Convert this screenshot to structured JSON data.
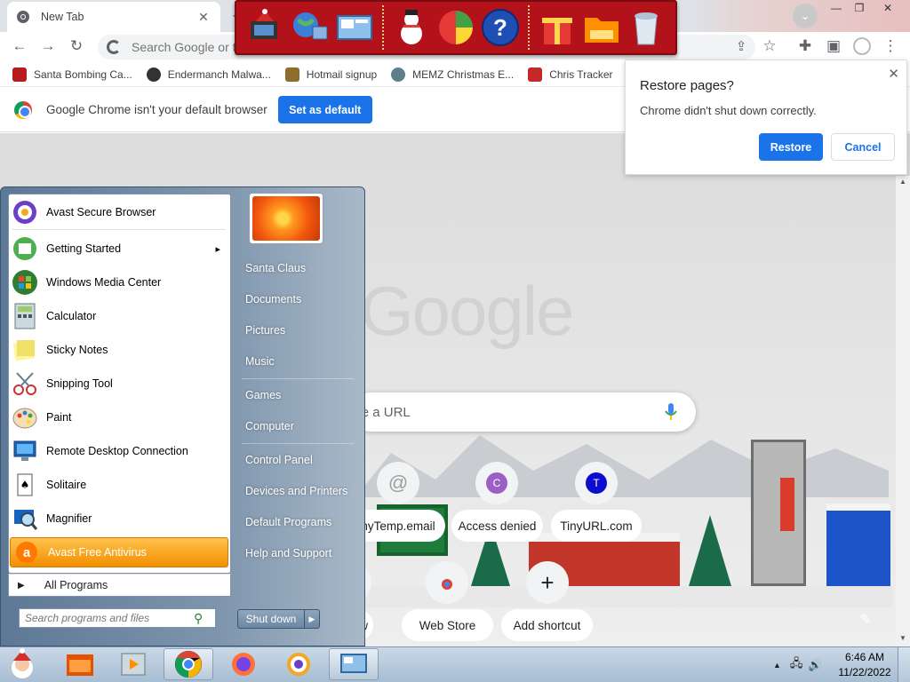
{
  "browser": {
    "tab_title": "New Tab",
    "omnibox_placeholder": "Search Google or type a URL",
    "bookmarks": [
      {
        "label": "Santa Bombing Ca...",
        "icon": "santa-icon",
        "color": "#b71c1c"
      },
      {
        "label": "Endermanch Malwa...",
        "icon": "skull-icon",
        "color": "#333333"
      },
      {
        "label": "Hotmail signup",
        "icon": "trophy-icon",
        "color": "#8d6e2b"
      },
      {
        "label": "MEMZ Christmas E...",
        "icon": "gear-icon",
        "color": "#607d8b"
      },
      {
        "label": "Chris Tracker",
        "icon": "star-icon",
        "color": "#c62828"
      }
    ],
    "infobar": {
      "message": "Google Chrome isn't your default browser",
      "button": "Set as default"
    },
    "restore_popup": {
      "title": "Restore pages?",
      "message": "Chrome didn't shut down correctly.",
      "restore": "Restore",
      "cancel": "Cancel"
    },
    "ntp": {
      "logo": "Google",
      "search_placeholder": "Search Google or type a URL",
      "shortcuts": [
        {
          "label": "TempTinyTemp.email",
          "visible_label": "nyTemp.email",
          "letter": "@",
          "color": "#9e9e9e"
        },
        {
          "label": "Access denied",
          "letter": "C",
          "color": "#9c5fc6"
        },
        {
          "label": "TinyURL.com",
          "letter": "T",
          "color": "#0d0dcf"
        }
      ],
      "bottom_shortcuts": [
        {
          "label": "w"
        },
        {
          "label": "Web Store"
        },
        {
          "label": "Add shortcut",
          "letter": "+"
        }
      ]
    }
  },
  "start_menu": {
    "programs": [
      {
        "label": "Avast Secure Browser",
        "icon": "avast-browser-icon"
      },
      {
        "label": "Getting Started",
        "icon": "getting-started-icon",
        "submenu": "▸"
      },
      {
        "label": "Windows Media Center",
        "icon": "media-center-icon"
      },
      {
        "label": "Calculator",
        "icon": "calculator-icon"
      },
      {
        "label": "Sticky Notes",
        "icon": "sticky-notes-icon"
      },
      {
        "label": "Snipping Tool",
        "icon": "scissors-icon"
      },
      {
        "label": "Paint",
        "icon": "paint-palette-icon"
      },
      {
        "label": "Remote Desktop Connection",
        "icon": "remote-desktop-icon"
      },
      {
        "label": "Solitaire",
        "icon": "cards-icon"
      },
      {
        "label": "Magnifier",
        "icon": "magnifier-icon"
      },
      {
        "label": "Avast Free Antivirus",
        "icon": "avast-icon"
      }
    ],
    "all_programs": "All Programs",
    "search_placeholder": "Search programs and files",
    "right_items": [
      {
        "label": "Santa Claus"
      },
      {
        "label": "Documents"
      },
      {
        "label": "Pictures"
      },
      {
        "label": "Music"
      },
      {
        "label": "Games"
      },
      {
        "label": "Computer"
      },
      {
        "label": "Control Panel"
      },
      {
        "label": "Devices and Printers"
      },
      {
        "label": "Default Programs"
      },
      {
        "label": "Help and Support"
      }
    ],
    "shutdown": "Shut down"
  },
  "taskbar": {
    "time": "6:46 AM",
    "date": "11/22/2022"
  },
  "colors": {
    "chrome_blue": "#1a73e8",
    "start_highlight": "#f28f00",
    "xmas_red": "#b3121a"
  }
}
